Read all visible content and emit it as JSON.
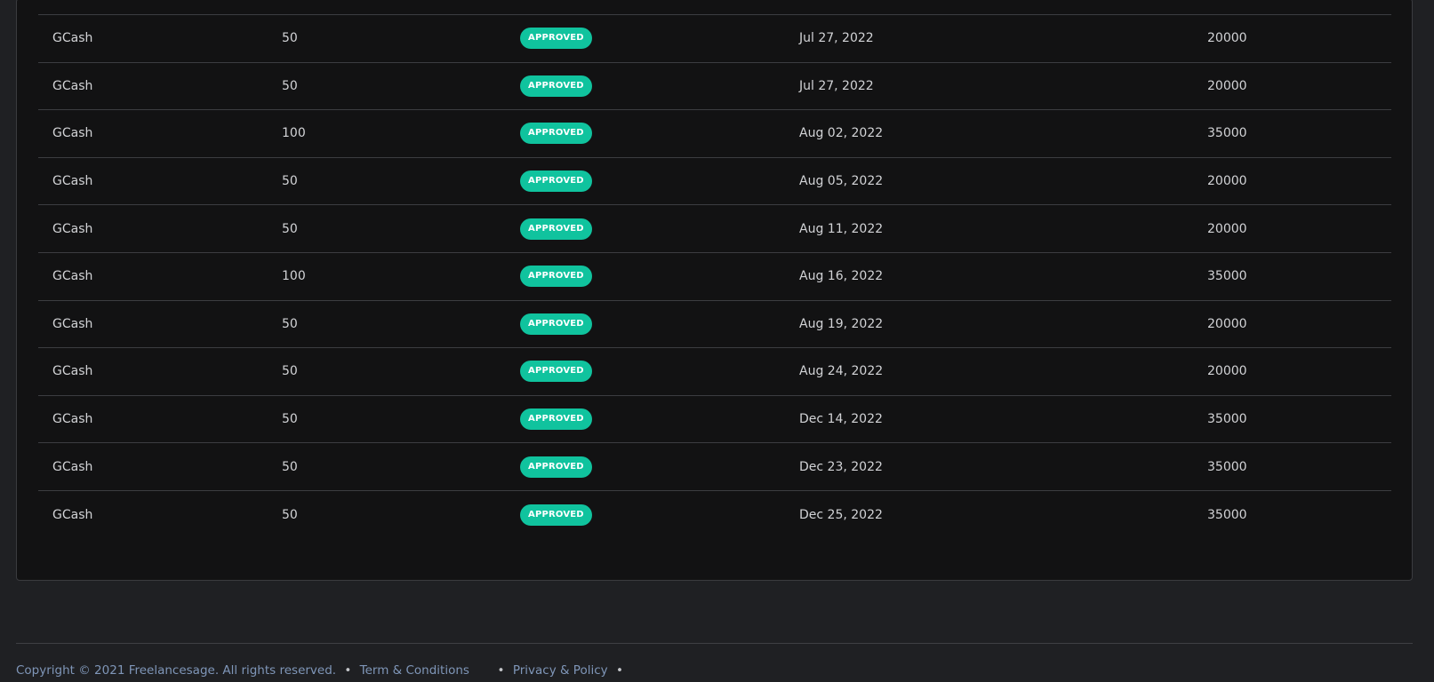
{
  "table": {
    "rows": [
      {
        "method": "GCash",
        "amount": "50",
        "status": "APPROVED",
        "date": "Jul 27, 2022",
        "total": "20000"
      },
      {
        "method": "GCash",
        "amount": "50",
        "status": "APPROVED",
        "date": "Jul 27, 2022",
        "total": "20000"
      },
      {
        "method": "GCash",
        "amount": "100",
        "status": "APPROVED",
        "date": "Aug 02, 2022",
        "total": "35000"
      },
      {
        "method": "GCash",
        "amount": "50",
        "status": "APPROVED",
        "date": "Aug 05, 2022",
        "total": "20000"
      },
      {
        "method": "GCash",
        "amount": "50",
        "status": "APPROVED",
        "date": "Aug 11, 2022",
        "total": "20000"
      },
      {
        "method": "GCash",
        "amount": "100",
        "status": "APPROVED",
        "date": "Aug 16, 2022",
        "total": "35000"
      },
      {
        "method": "GCash",
        "amount": "50",
        "status": "APPROVED",
        "date": "Aug 19, 2022",
        "total": "20000"
      },
      {
        "method": "GCash",
        "amount": "50",
        "status": "APPROVED",
        "date": "Aug 24, 2022",
        "total": "20000"
      },
      {
        "method": "GCash",
        "amount": "50",
        "status": "APPROVED",
        "date": "Dec 14, 2022",
        "total": "35000"
      },
      {
        "method": "GCash",
        "amount": "50",
        "status": "APPROVED",
        "date": "Dec 23, 2022",
        "total": "35000"
      },
      {
        "method": "GCash",
        "amount": "50",
        "status": "APPROVED",
        "date": "Dec 25, 2022",
        "total": "35000"
      }
    ]
  },
  "footer": {
    "copyright": "Copyright © 2021 Freelancesage. All rights reserved.",
    "separator": "•",
    "terms_label": "Term & Conditions",
    "privacy_label": "Privacy & Policy"
  },
  "colors": {
    "background": "#1f2023",
    "panel": "#121213",
    "badge": "#10c39e",
    "footer_link": "#7f96b8"
  }
}
